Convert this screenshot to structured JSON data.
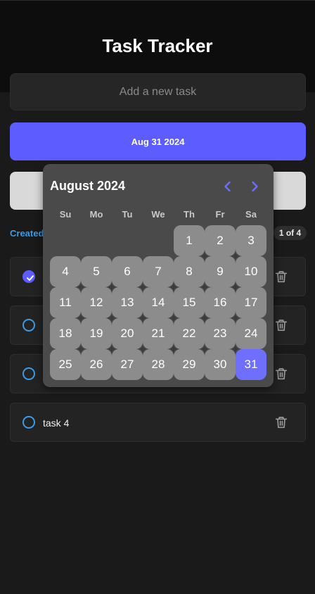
{
  "app": {
    "title": "Task Tracker"
  },
  "new_task": {
    "placeholder": "Add a new task",
    "value": ""
  },
  "date_button": {
    "label": "Aug 31 2024"
  },
  "add_button": {
    "label": ""
  },
  "sort": {
    "label": "Created"
  },
  "pagination": {
    "label": "1 of 4"
  },
  "tasks": [
    {
      "label": "",
      "completed": true
    },
    {
      "label": "",
      "completed": false
    },
    {
      "label": "",
      "completed": false
    },
    {
      "label": "task 4",
      "completed": false
    }
  ],
  "calendar": {
    "month_label": "August 2024",
    "weekdays": [
      "Su",
      "Mo",
      "Tu",
      "We",
      "Th",
      "Fr",
      "Sa"
    ],
    "first_weekday_index": 4,
    "days_in_month": 31,
    "selected_day": 31,
    "colors": {
      "accent": "#6e6eff",
      "day_bg": "#8c8c8c",
      "popup_bg": "#4a4a4a"
    }
  },
  "colors": {
    "primary": "#5c5cff",
    "link": "#3a9be6",
    "background": "#1a1a1a"
  },
  "icons": {
    "prev": "chevron-left-icon",
    "next": "chevron-right-icon",
    "delete": "trash-icon",
    "done": "check-circle-icon",
    "todo": "circle-icon"
  }
}
